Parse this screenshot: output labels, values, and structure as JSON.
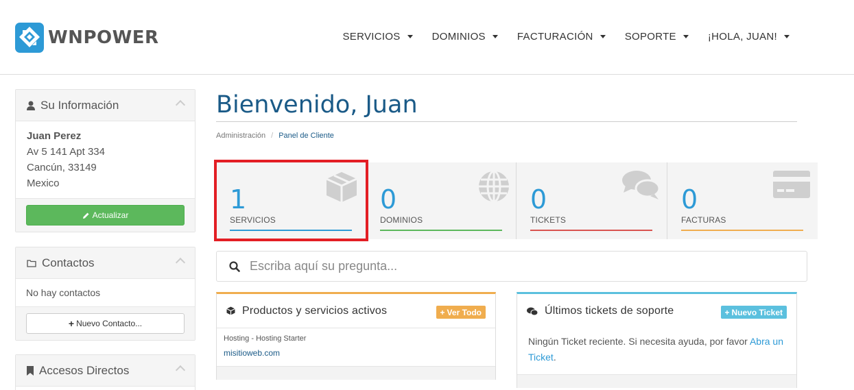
{
  "header": {
    "brand": "WNPOWER",
    "nav": [
      {
        "label": "SERVICIOS"
      },
      {
        "label": "DOMINIOS"
      },
      {
        "label": "FACTURACIÓN"
      },
      {
        "label": "SOPORTE"
      },
      {
        "label": "¡HOLA, JUAN!"
      }
    ]
  },
  "sidebar": {
    "info": {
      "title": "Su Información",
      "name": "Juan Perez",
      "address1": "Av 5 141 Apt 334",
      "address2": "Cancún, 33149",
      "country": "Mexico",
      "update_button": "Actualizar"
    },
    "contacts": {
      "title": "Contactos",
      "empty_text": "No hay contactos",
      "new_button": "Nuevo Contacto..."
    },
    "shortcuts": {
      "title": "Accesos Directos"
    }
  },
  "main": {
    "title": "Bienvenido, Juan",
    "breadcrumb": [
      "Administración",
      "Panel de Cliente"
    ],
    "stats": [
      {
        "value": "1",
        "label": "SERVICIOS",
        "color": "#2d9ad6",
        "icon": "cube-icon"
      },
      {
        "value": "0",
        "label": "DOMINIOS",
        "color": "#5cb85c",
        "icon": "globe-icon"
      },
      {
        "value": "0",
        "label": "TICKETS",
        "color": "#d9534f",
        "icon": "comments-icon"
      },
      {
        "value": "0",
        "label": "FACTURAS",
        "color": "#f0ad4e",
        "icon": "credit-card-icon"
      }
    ],
    "search_placeholder": "Escriba aquí su pregunta...",
    "products_card": {
      "title": "Productos y servicios activos",
      "badge": "Ver Todo",
      "item_name": "Hosting - Hosting Starter",
      "item_domain": "misitioweb.com"
    },
    "tickets_card": {
      "title": "Últimos tickets de soporte",
      "badge": "Nuevo Ticket",
      "text": "Ningún Ticket reciente. Si necesita ayuda, por favor",
      "link": "Abra un Ticket"
    }
  },
  "colors": {
    "primary": "#1a5a87",
    "accent_blue": "#2d9ad6",
    "green": "#5cb85c",
    "orange": "#f0ad4e",
    "red": "#d9534f",
    "highlight": "#e31e24",
    "info": "#5bc0de"
  }
}
